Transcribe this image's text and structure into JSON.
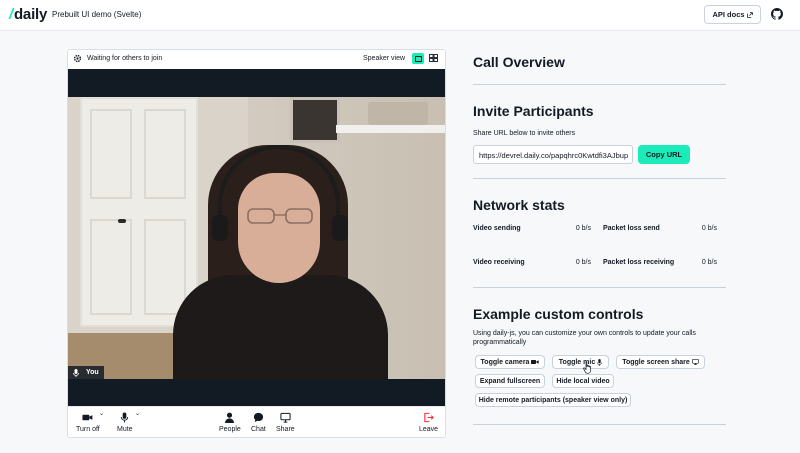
{
  "header": {
    "logo_slash": "/",
    "logo_text": "daily",
    "app_title": "Prebuilt UI demo (Svelte)",
    "api_docs_label": "API docs",
    "api_docs_icon": "external-link-icon",
    "github_icon": "github-icon"
  },
  "call": {
    "status_text": "Waiting for others to join",
    "view_label": "Speaker view",
    "participant_name": "You",
    "controls": {
      "camera_label": "Turn off",
      "mic_label": "Mute",
      "people_label": "People",
      "chat_label": "Chat",
      "share_label": "Share",
      "leave_label": "Leave"
    }
  },
  "overview": {
    "title": "Call Overview"
  },
  "invite": {
    "title": "Invite Participants",
    "description": "Share URL below to invite others",
    "url_value": "https://devrel.daily.co/papqhrc0Kwtdfi3AJbup",
    "copy_label": "Copy URL"
  },
  "network": {
    "title": "Network stats",
    "video_sending_label": "Video sending",
    "video_sending_value": "0 b/s",
    "packet_loss_send_label": "Packet loss send",
    "packet_loss_send_value": "0 b/s",
    "video_receiving_label": "Video receiving",
    "video_receiving_value": "0 b/s",
    "packet_loss_receiving_label": "Packet loss receiving",
    "packet_loss_receiving_value": "0 b/s"
  },
  "custom_controls": {
    "title": "Example custom controls",
    "description": "Using daily-js, you can customize your own controls to update your calls programmatically",
    "toggle_camera": "Toggle camera",
    "toggle_mic": "Toggle mic",
    "toggle_screen_share": "Toggle screen share",
    "expand_fullscreen": "Expand fullscreen",
    "hide_local_video": "Hide local video",
    "hide_remote": "Hide remote participants (speaker view only)"
  },
  "colors": {
    "accent": "#1bebb9",
    "leave": "#f63135",
    "text": "#121a24",
    "background": "#f6f8fa"
  }
}
